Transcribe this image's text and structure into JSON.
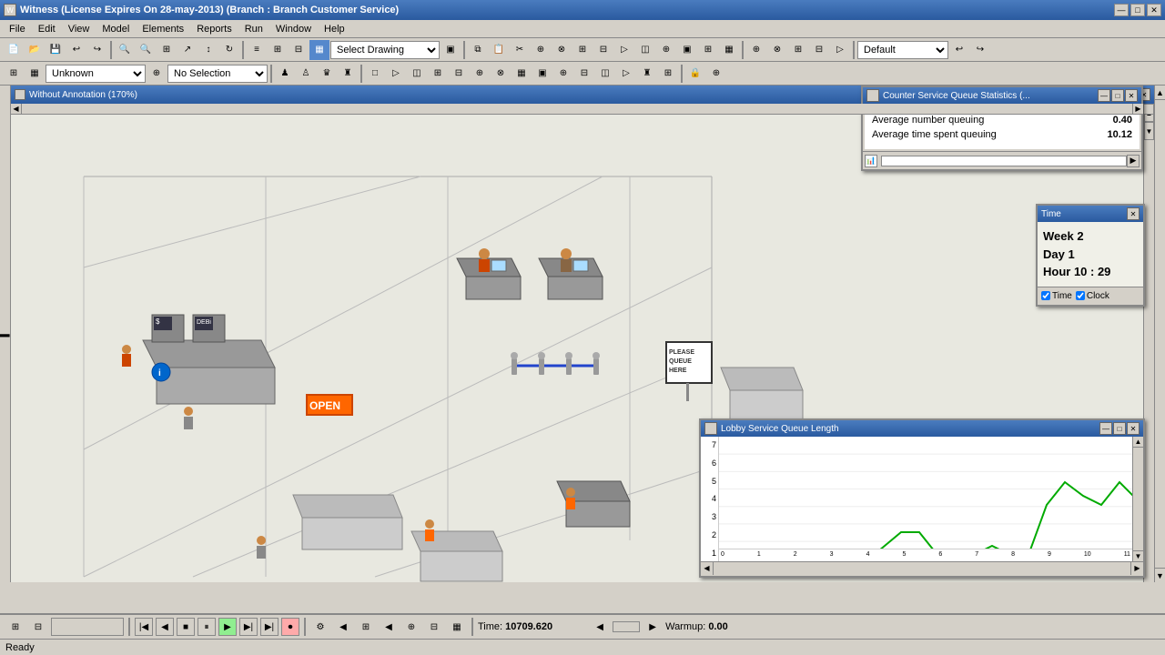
{
  "titleBar": {
    "title": "Witness (License Expires On 28-may-2013) (Branch : Branch Customer Service)",
    "minimize": "—",
    "maximize": "□",
    "close": "✕"
  },
  "menuBar": {
    "items": [
      "File",
      "Edit",
      "View",
      "Model",
      "Elements",
      "Reports",
      "Run",
      "Window",
      "Help"
    ]
  },
  "toolbar": {
    "drawingDropdown": "Select Drawing",
    "defaultDropdown": "Default"
  },
  "toolbar2": {
    "unknownDropdown": "Unknown",
    "noSelectionDropdown": "No Selection"
  },
  "canvasWindow": {
    "title": "Without Annotation (170%)"
  },
  "statsWindow": {
    "title": "Counter Service Queue Statistics (...",
    "rows": [
      {
        "label": "Average number queuing",
        "value": "0.40"
      },
      {
        "label": "Average time spent queuing",
        "value": "10.12"
      }
    ]
  },
  "timeWindow": {
    "title": "Time",
    "week": "Week  2",
    "day": "Day  1",
    "hour": "Hour 10 : 29",
    "timeLabel": "Time",
    "clockLabel": "Clock"
  },
  "queueWindow": {
    "title": "Lobby Service Queue Length",
    "yAxisMax": 7,
    "yAxisLabels": [
      "7",
      "6",
      "5",
      "4",
      "3",
      "2",
      "1"
    ]
  },
  "statusBar": {
    "timeLabel": "Time:",
    "timeValue": "10709.620",
    "warmupLabel": "Warmup:",
    "warmupValue": "0.00"
  },
  "readyBar": {
    "text": "Ready"
  },
  "openSign": "OPEN",
  "pleaseQueueSign": "PLEASE\nQUEUE\nHERE",
  "machines": {
    "atm": "$",
    "debit": "DEBi"
  }
}
